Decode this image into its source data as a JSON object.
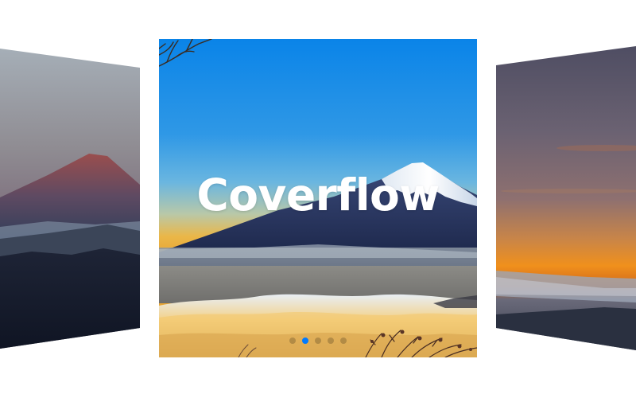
{
  "coverflow": {
    "caption": "Coverflow",
    "active_index": 1,
    "accent_color": "#007aff",
    "slides": [
      {
        "scene": "mountain-dusk"
      },
      {
        "scene": "mount-fuji-sunrise-sea-of-clouds"
      },
      {
        "scene": "sunset-sea-of-clouds"
      }
    ],
    "pagination": [
      {
        "state": "inactive"
      },
      {
        "state": "active"
      },
      {
        "state": "inactive"
      },
      {
        "state": "inactive"
      },
      {
        "state": "inactive"
      }
    ]
  }
}
